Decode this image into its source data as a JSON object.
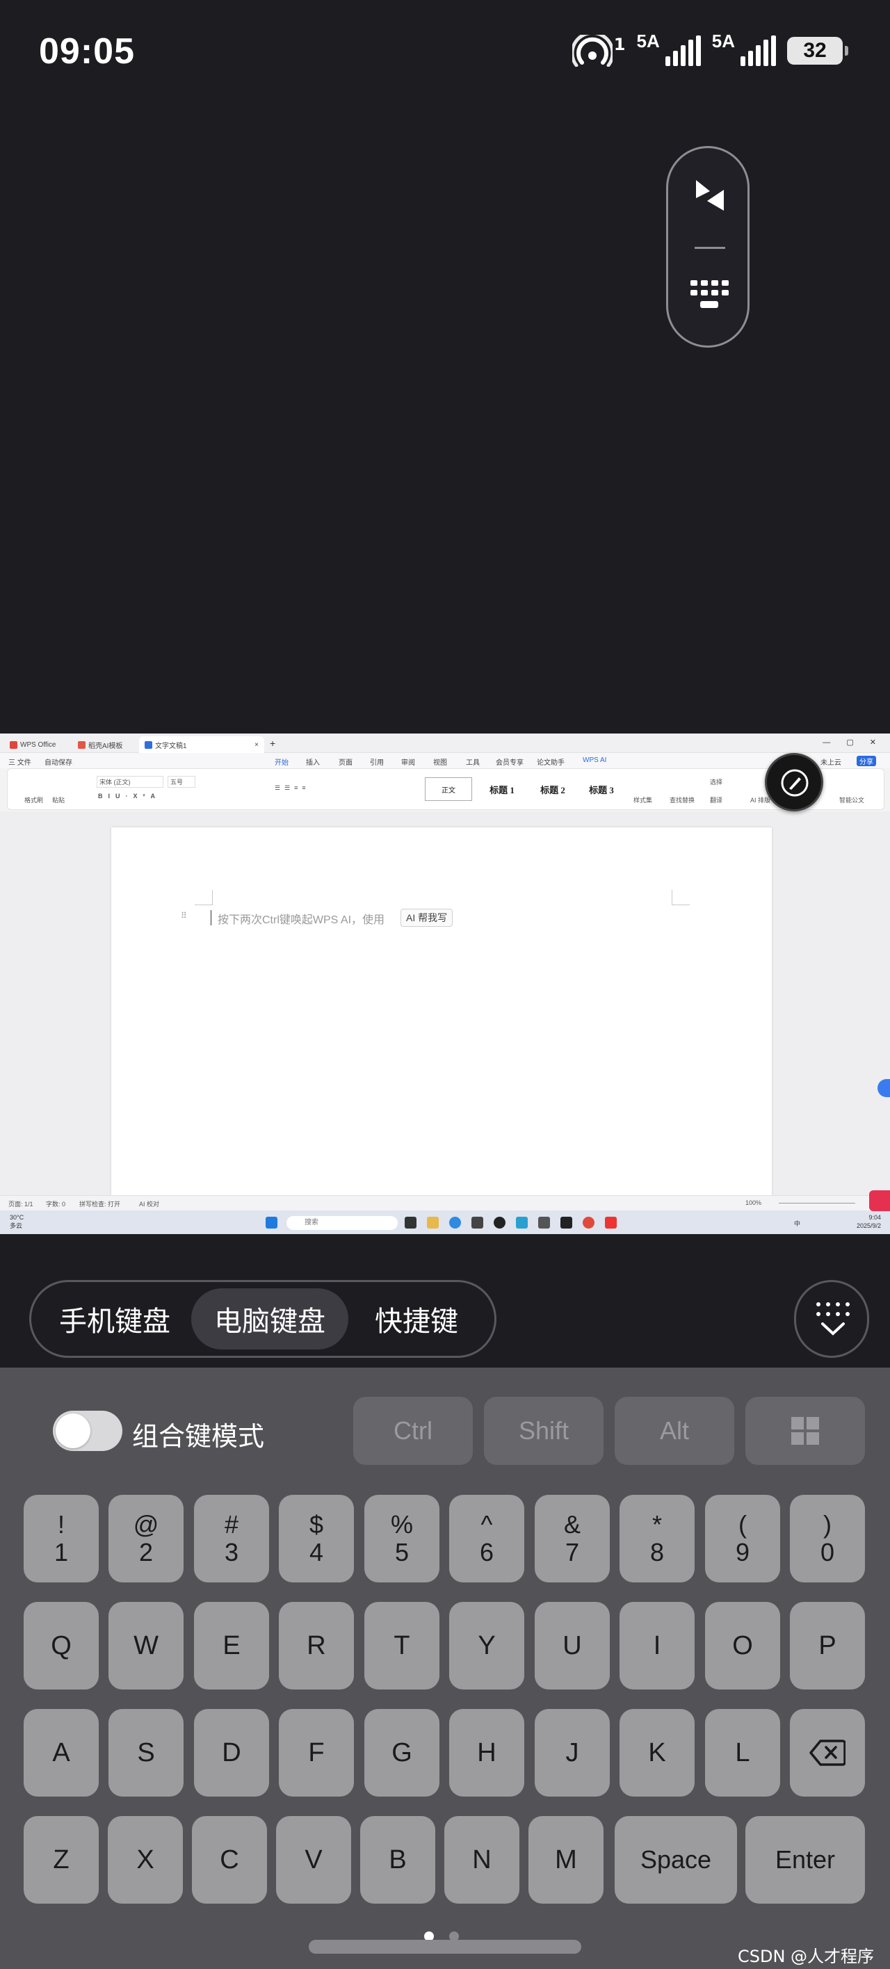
{
  "status": {
    "time": "09:05",
    "hotspot_sup": "1",
    "sim1": "5A",
    "sim2": "5A",
    "battery": "32"
  },
  "screen": {
    "tabs": [
      "WPS Office",
      "稻壳AI模板",
      "文字文稿1"
    ],
    "menu": [
      "三 文件",
      "自动保存",
      "开始",
      "插入",
      "页面",
      "引用",
      "审阅",
      "视图",
      "工具",
      "会员专享",
      "论文助手",
      "WPS AI",
      "未上云",
      "分享"
    ],
    "ribbon": {
      "font_name": "宋体 (正文)",
      "font_size": "五号",
      "styles": [
        "正文",
        "标题 1",
        "标题 2",
        "标题 3"
      ],
      "labels": [
        "格式刷",
        "粘贴",
        "样式集",
        "查找替换",
        "选择",
        "翻译",
        "AI 排版",
        "智能公文"
      ]
    },
    "doc": {
      "hint": "按下两次Ctrl键唤起WPS AI，使用",
      "ai_button": "AI 帮我写"
    },
    "statusline": [
      "页面: 1/1",
      "字数: 0",
      "拼写检查: 打开",
      "AI 校对",
      "100%"
    ],
    "taskbar": {
      "weather_temp": "30°C",
      "weather_text": "多云",
      "search": "搜索",
      "ime": "中",
      "clock_time": "9:04",
      "clock_date": "2025/9/2"
    }
  },
  "modes": {
    "items": [
      "手机键盘",
      "电脑键盘",
      "快捷键"
    ],
    "selected": "电脑键盘"
  },
  "keyboard": {
    "combo_label": "组合键模式",
    "modifiers": [
      "Ctrl",
      "Shift",
      "Alt"
    ],
    "number_row": [
      [
        "!",
        "1"
      ],
      [
        "@",
        "2"
      ],
      [
        "#",
        "3"
      ],
      [
        "$",
        "4"
      ],
      [
        "%",
        "5"
      ],
      [
        "^",
        "6"
      ],
      [
        "&",
        "7"
      ],
      [
        "*",
        "8"
      ],
      [
        "(",
        "9"
      ],
      [
        ")",
        "0"
      ]
    ],
    "row1": [
      "Q",
      "W",
      "E",
      "R",
      "T",
      "Y",
      "U",
      "I",
      "O",
      "P"
    ],
    "row2": [
      "A",
      "S",
      "D",
      "F",
      "G",
      "H",
      "J",
      "K",
      "L"
    ],
    "row3": [
      "Z",
      "X",
      "C",
      "V",
      "B",
      "N",
      "M"
    ],
    "space": "Space",
    "enter": "Enter"
  },
  "watermark": "CSDN @人才程序员",
  "colors": {
    "accent": "#2b6be0",
    "keyboard_bg": "#535357",
    "key": "#9c9c9f"
  }
}
